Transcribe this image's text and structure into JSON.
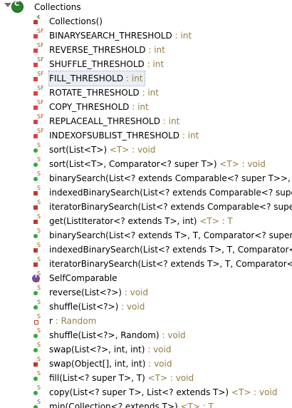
{
  "outline": {
    "root": {
      "label": "Collections",
      "icon": "class-icon"
    },
    "items": [
      {
        "kind": "ctor",
        "name": "Collections()",
        "type": ""
      },
      {
        "kind": "field-final",
        "name": "BINARYSEARCH_THRESHOLD",
        "type": " : int"
      },
      {
        "kind": "field-final",
        "name": "REVERSE_THRESHOLD",
        "type": " : int"
      },
      {
        "kind": "field-final",
        "name": "SHUFFLE_THRESHOLD",
        "type": " : int"
      },
      {
        "kind": "field-final",
        "name": "FILL_THRESHOLD",
        "type": " : int",
        "selected": true
      },
      {
        "kind": "field-final",
        "name": "ROTATE_THRESHOLD",
        "type": " : int"
      },
      {
        "kind": "field-final",
        "name": "COPY_THRESHOLD",
        "type": " : int"
      },
      {
        "kind": "field-final",
        "name": "REPLACEALL_THRESHOLD",
        "type": " : int"
      },
      {
        "kind": "field-final",
        "name": "INDEXOFSUBLIST_THRESHOLD",
        "type": " : int"
      },
      {
        "kind": "public",
        "name": "sort(List<T>)",
        "type": " <T> : void"
      },
      {
        "kind": "public",
        "name": "sort(List<T>, Comparator<? super T>)",
        "type": " <T> : void"
      },
      {
        "kind": "public",
        "name": "binarySearch(List<? extends Comparable<? super T>>, T)",
        "type": ""
      },
      {
        "kind": "private",
        "name": "indexedBinarySearch(List<? extends Comparable<? super",
        "type": ""
      },
      {
        "kind": "private",
        "name": "iteratorBinarySearch(List<? extends Comparable<? super T",
        "type": ""
      },
      {
        "kind": "private",
        "name": "get(ListIterator<? extends T>, int)",
        "type": " <T> : T"
      },
      {
        "kind": "public",
        "name": "binarySearch(List<? extends T>, T, Comparator<? super T",
        "type": ""
      },
      {
        "kind": "private",
        "name": "indexedBinarySearch(List<? extends T>, T, Comparator<?",
        "type": ""
      },
      {
        "kind": "private",
        "name": "iteratorBinarySearch(List<? extends T>, T, Comparator<? s",
        "type": ""
      },
      {
        "kind": "interface",
        "name": "SelfComparable",
        "type": ""
      },
      {
        "kind": "public",
        "name": "reverse(List<?>)",
        "type": " : void"
      },
      {
        "kind": "public",
        "name": "shuffle(List<?>)",
        "type": " : void"
      },
      {
        "kind": "field-private",
        "name": "r",
        "type": " : Random"
      },
      {
        "kind": "public",
        "name": "shuffle(List<?>, Random)",
        "type": " : void"
      },
      {
        "kind": "public",
        "name": "swap(List<?>, int, int)",
        "type": " : void"
      },
      {
        "kind": "private",
        "name": "swap(Object[], int, int)",
        "type": " : void"
      },
      {
        "kind": "public",
        "name": "fill(List<? super T>, T)",
        "type": " <T> : void"
      },
      {
        "kind": "public",
        "name": "copy(List<? super T>, List<? extends T>)",
        "type": " <T> : void"
      },
      {
        "kind": "public",
        "name": "min(Collection<? extends T>)",
        "type": " <T> : T"
      }
    ]
  },
  "colors": {
    "type_text": "#957d47",
    "selection": "#e9eef6"
  }
}
